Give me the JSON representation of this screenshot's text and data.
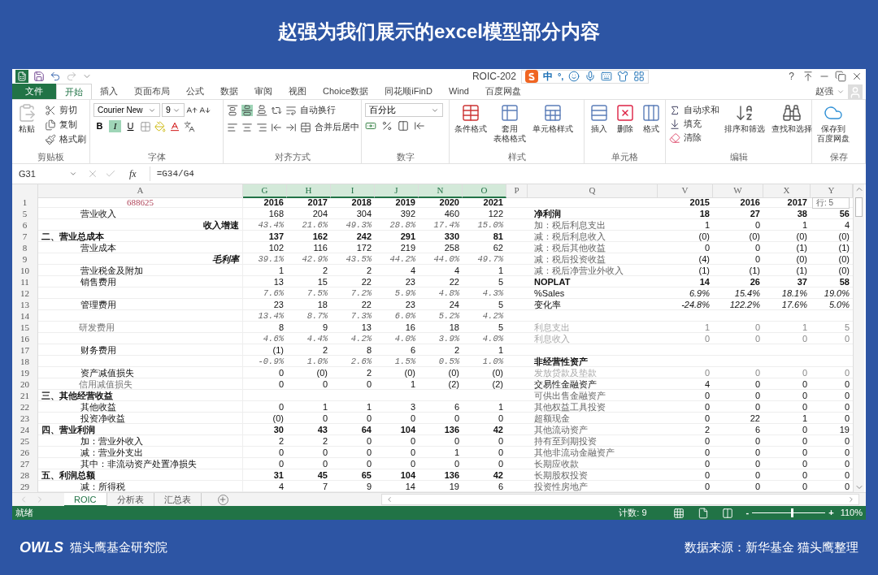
{
  "slide_title": "赵强为我们展示的excel模型部分内容",
  "window": {
    "title": "ROIC-202",
    "ime_mode": "中",
    "ime_punct": "°,",
    "help": "?",
    "user": "赵强"
  },
  "tabs": [
    {
      "label": "文件",
      "kind": "file",
      "selected": false
    },
    {
      "label": "开始",
      "kind": "tab",
      "selected": true
    },
    {
      "label": "插入",
      "kind": "tab",
      "selected": false
    },
    {
      "label": "页面布局",
      "kind": "tab",
      "selected": false
    },
    {
      "label": "公式",
      "kind": "tab",
      "selected": false
    },
    {
      "label": "数据",
      "kind": "tab",
      "selected": false
    },
    {
      "label": "审阅",
      "kind": "tab",
      "selected": false
    },
    {
      "label": "视图",
      "kind": "tab",
      "selected": false
    },
    {
      "label": "Choice数据",
      "kind": "tab",
      "selected": false
    },
    {
      "label": "同花顺iFinD",
      "kind": "tab",
      "selected": false
    },
    {
      "label": "Wind",
      "kind": "tab",
      "selected": false
    },
    {
      "label": "百度网盘",
      "kind": "tab",
      "selected": false
    }
  ],
  "ribbon": [
    {
      "label": "剪贴板",
      "kind": "clipboard",
      "paste": "粘贴",
      "items": [
        "剪切",
        "复制",
        "格式刷"
      ]
    },
    {
      "label": "字体",
      "kind": "font",
      "font": "Courier New",
      "size": "9",
      "styles": [
        {
          "label": "B",
          "selected": false
        },
        {
          "label": "I",
          "selected": true
        },
        {
          "label": "U",
          "selected": false
        }
      ]
    },
    {
      "label": "对齐方式",
      "kind": "align",
      "wrap": "自动换行",
      "merge": "合并后居中"
    },
    {
      "label": "数字",
      "kind": "number",
      "format": "百分比"
    },
    {
      "label": "样式",
      "kind": "styles",
      "items": [
        [
          "条件格式"
        ],
        [
          "套用",
          "表格格式"
        ],
        [
          "单元格样式"
        ]
      ]
    },
    {
      "label": "单元格",
      "kind": "cells",
      "items": [
        [
          "插入"
        ],
        [
          "删除"
        ],
        [
          "格式"
        ]
      ]
    },
    {
      "label": "编辑",
      "kind": "editing",
      "small": [
        "自动求和",
        "填充",
        "清除"
      ],
      "items": [
        [
          "排序和筛选"
        ],
        [
          "查找和选择"
        ]
      ]
    },
    {
      "label": "保存",
      "kind": "save",
      "items": [
        [
          "保存到",
          "百度网盘"
        ]
      ]
    }
  ],
  "formula_bar": {
    "cell": "G31",
    "fx": "fx",
    "formula": "=G34/G4"
  },
  "columns": [
    {
      "label": "A",
      "selected": false
    },
    {
      "label": "G",
      "selected": true
    },
    {
      "label": "H",
      "selected": true
    },
    {
      "label": "I",
      "selected": true
    },
    {
      "label": "J",
      "selected": true
    },
    {
      "label": "N",
      "selected": true
    },
    {
      "label": "O",
      "selected": true
    },
    {
      "label": "P",
      "selected": false
    },
    {
      "label": "Q",
      "selected": false
    },
    {
      "label": "V",
      "selected": false
    },
    {
      "label": "W",
      "selected": false
    },
    {
      "label": "X",
      "selected": false
    },
    {
      "label": "Y",
      "selected": false
    }
  ],
  "rows": [
    {
      "num": "1",
      "kind": "header",
      "label": "688625",
      "values": [
        "2016",
        "2017",
        "2018",
        "2019",
        "2020",
        "2021"
      ],
      "right": {
        "kind": "header",
        "values": [
          "2015",
          "2016",
          "2017"
        ]
      }
    },
    {
      "num": "5",
      "kind": "item",
      "label": "营业收入",
      "values": [
        "168",
        "204",
        "304",
        "392",
        "460",
        "122"
      ],
      "right": {
        "kind": "bold",
        "label": "净利润",
        "values": [
          "18",
          "27",
          "38",
          "56"
        ]
      }
    },
    {
      "num": "6",
      "kind": "ratio",
      "label": "收入增速",
      "values": [
        "43.4%",
        "21.6%",
        "49.3%",
        "28.8%",
        "17.4%",
        "15.0%"
      ],
      "right": {
        "kind": "muted",
        "label": "加：税后利息支出",
        "values": [
          "1",
          "0",
          "1",
          "4"
        ]
      }
    },
    {
      "num": "7",
      "kind": "section",
      "label": "二、营业总成本",
      "values": [
        "137",
        "162",
        "242",
        "291",
        "330",
        "81"
      ],
      "right": {
        "kind": "muted",
        "label": "减：税后利息收入",
        "values": [
          "(0)",
          "(0)",
          "(0)",
          "(0)"
        ]
      }
    },
    {
      "num": "8",
      "kind": "item",
      "label": "营业成本",
      "values": [
        "102",
        "116",
        "172",
        "219",
        "258",
        "62"
      ],
      "right": {
        "kind": "muted",
        "label": "减：税后其他收益",
        "values": [
          "0",
          "0",
          "(1)",
          "(1)"
        ]
      }
    },
    {
      "num": "9",
      "kind": "ratio_italic",
      "label": "毛利率",
      "values": [
        "39.1%",
        "42.9%",
        "43.5%",
        "44.2%",
        "44.0%",
        "49.7%"
      ],
      "right": {
        "kind": "muted",
        "label": "减：税后投资收益",
        "values": [
          "(4)",
          "0",
          "(0)",
          "(0)"
        ]
      }
    },
    {
      "num": "10",
      "kind": "item",
      "label": "营业税金及附加",
      "values": [
        "1",
        "2",
        "2",
        "4",
        "4",
        "1"
      ],
      "right": {
        "kind": "muted",
        "label": "减：税后净营业外收入",
        "values": [
          "(1)",
          "(1)",
          "(1)",
          "(0)"
        ]
      }
    },
    {
      "num": "11",
      "kind": "item",
      "label": "销售费用",
      "values": [
        "13",
        "15",
        "22",
        "23",
        "22",
        "5"
      ],
      "right": {
        "kind": "bold",
        "label": "NOPLAT",
        "values": [
          "14",
          "26",
          "37",
          "58"
        ]
      }
    },
    {
      "num": "12",
      "kind": "pct",
      "values": [
        "7.6%",
        "7.5%",
        "7.2%",
        "5.9%",
        "4.8%",
        "4.3%"
      ],
      "right": {
        "kind": "pct",
        "label": "%Sales",
        "values": [
          "6.9%",
          "15.4%",
          "18.1%",
          "19.0%"
        ]
      }
    },
    {
      "num": "13",
      "kind": "item",
      "label": "管理费用",
      "values": [
        "23",
        "18",
        "22",
        "23",
        "24",
        "5"
      ],
      "right": {
        "kind": "pct",
        "label": "变化率",
        "values": [
          "-24.8%",
          "122.2%",
          "17.6%",
          "5.0%"
        ]
      }
    },
    {
      "num": "14",
      "kind": "pct",
      "values": [
        "13.4%",
        "8.7%",
        "7.3%",
        "6.0%",
        "5.2%",
        "4.2%"
      ]
    },
    {
      "num": "15",
      "kind": "muted_item",
      "label": "研发费用",
      "values": [
        "8",
        "9",
        "13",
        "16",
        "18",
        "5"
      ],
      "right": {
        "kind": "faint",
        "label": "利息支出",
        "values": [
          "1",
          "0",
          "1",
          "5"
        ]
      }
    },
    {
      "num": "16",
      "kind": "pct",
      "values": [
        "4.6%",
        "4.4%",
        "4.2%",
        "4.0%",
        "3.9%",
        "4.0%"
      ],
      "right": {
        "kind": "faint",
        "label": "利息收入",
        "values": [
          "0",
          "0",
          "0",
          "0"
        ]
      }
    },
    {
      "num": "17",
      "kind": "item",
      "label": "财务费用",
      "values": [
        "(1)",
        "2",
        "8",
        "6",
        "2",
        "1"
      ]
    },
    {
      "num": "18",
      "kind": "pct",
      "values": [
        "-0.9%",
        "1.0%",
        "2.6%",
        "1.5%",
        "0.5%",
        "1.0%"
      ],
      "right": {
        "kind": "bold",
        "label": "非经营性资产"
      }
    },
    {
      "num": "19",
      "kind": "item",
      "label": "资产减值损失",
      "values": [
        "0",
        "(0)",
        "2",
        "(0)",
        "(0)",
        "(0)"
      ],
      "right": {
        "kind": "faint",
        "label": "发放贷款及垫款",
        "values": [
          "0",
          "0",
          "0",
          "0"
        ]
      }
    },
    {
      "num": "20",
      "kind": "muted_item",
      "label": "信用减值损失",
      "values": [
        "0",
        "0",
        "0",
        "1",
        "(2)",
        "(2)"
      ],
      "right": {
        "kind": "plain",
        "label": "交易性金融资产",
        "values": [
          "4",
          "0",
          "0",
          "0"
        ]
      }
    },
    {
      "num": "21",
      "kind": "section",
      "label": "三、其他经营收益",
      "right": {
        "kind": "muted",
        "label": "可供出售金融资产",
        "values": [
          "0",
          "0",
          "0",
          "0"
        ]
      }
    },
    {
      "num": "22",
      "kind": "item",
      "label": "其他收益",
      "values": [
        "0",
        "1",
        "1",
        "3",
        "6",
        "1"
      ],
      "right": {
        "kind": "muted",
        "label": "其他权益工具投资",
        "values": [
          "0",
          "0",
          "0",
          "0"
        ]
      }
    },
    {
      "num": "23",
      "kind": "item",
      "label": "投资净收益",
      "values": [
        "(0)",
        "0",
        "0",
        "0",
        "0",
        "0"
      ],
      "right": {
        "kind": "muted",
        "label": "超额现金",
        "values": [
          "0",
          "22",
          "1",
          "0"
        ]
      }
    },
    {
      "num": "24",
      "kind": "section",
      "label": "四、营业利润",
      "values": [
        "30",
        "43",
        "64",
        "104",
        "136",
        "42"
      ],
      "right": {
        "kind": "muted",
        "label": "其他流动资产",
        "values": [
          "2",
          "6",
          "0",
          "19"
        ]
      }
    },
    {
      "num": "25",
      "kind": "item",
      "label": "加：营业外收入",
      "values": [
        "2",
        "2",
        "0",
        "0",
        "0",
        "0"
      ],
      "right": {
        "kind": "muted",
        "label": "持有至到期投资",
        "values": [
          "0",
          "0",
          "0",
          "0"
        ]
      }
    },
    {
      "num": "26",
      "kind": "item",
      "label": "减：营业外支出",
      "values": [
        "0",
        "0",
        "0",
        "0",
        "1",
        "0"
      ],
      "right": {
        "kind": "muted",
        "label": "其他非流动金融资产",
        "values": [
          "0",
          "0",
          "0",
          "0"
        ]
      }
    },
    {
      "num": "27",
      "kind": "item",
      "label": "其中：非流动资产处置净损失",
      "values": [
        "0",
        "0",
        "0",
        "0",
        "0",
        "0"
      ],
      "right": {
        "kind": "muted",
        "label": "长期应收款",
        "values": [
          "0",
          "0",
          "0",
          "0"
        ]
      }
    },
    {
      "num": "28",
      "kind": "section",
      "label": "五、利润总额",
      "values": [
        "31",
        "45",
        "65",
        "104",
        "136",
        "42"
      ],
      "right": {
        "kind": "muted",
        "label": "长期股权投资",
        "values": [
          "0",
          "0",
          "0",
          "0"
        ]
      }
    },
    {
      "num": "29",
      "kind": "item",
      "label": "减：所得税",
      "values": [
        "4",
        "7",
        "9",
        "14",
        "19",
        "6"
      ],
      "right": {
        "kind": "muted",
        "label": "投资性房地产",
        "values": [
          "0",
          "0",
          "0",
          "0"
        ]
      }
    }
  ],
  "scroll_tip": "行: 5",
  "sheets": [
    {
      "label": "ROIC",
      "selected": true
    },
    {
      "label": "分析表",
      "selected": false
    },
    {
      "label": "汇总表",
      "selected": false
    }
  ],
  "status": {
    "ready": "就绪",
    "count": "计数: 9",
    "minus": "-",
    "plus": "+",
    "level": 0.55,
    "zoom": "110%"
  },
  "footer": {
    "mark": "OWLS",
    "brand": "猫头鹰基金研究院",
    "source": "数据来源：新华基金  猫头鹰整理"
  }
}
